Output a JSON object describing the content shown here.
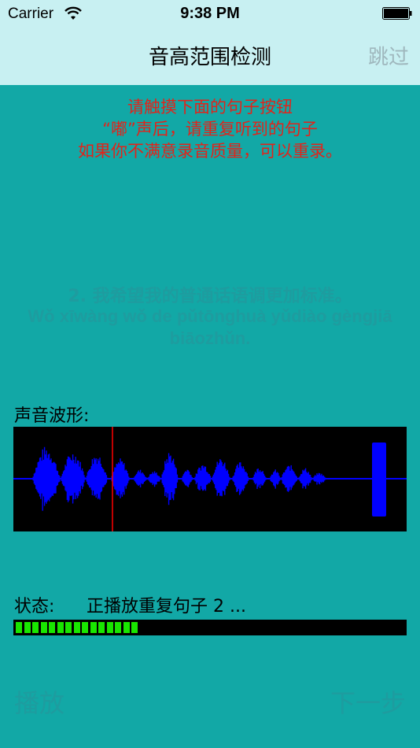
{
  "status_bar": {
    "carrier": "Carrier",
    "time": "9:38 PM"
  },
  "nav": {
    "title": "音高范围检测",
    "skip": "跳过"
  },
  "instructions": [
    "请触摸下面的句子按钮",
    "“嘟”声后，请重复听到的句子",
    "如果你不满意录音质量，可以重录。"
  ],
  "sentence": {
    "chinese": "2. 我希望我的普通话语调更加标准。",
    "pinyin": "Wǒ xīwàng wǒ de pǔtōnghuà yǔdiào gèngjiā biāozhǔn."
  },
  "waveform": {
    "label": "声音波形:",
    "wave_color": "#0000FF",
    "cursor_color": "#FF0000"
  },
  "status": {
    "label": "状态:",
    "text": "正播放重复句子 2 ...",
    "progress": 0.33
  },
  "buttons": {
    "play": "播放",
    "next": "下一步"
  },
  "colors": {
    "background": "#12A8A6",
    "header": "#C8F0F2",
    "instruction_text": "#E2231A",
    "progress": "#19E600"
  },
  "icons": [
    "wifi-icon",
    "battery-icon"
  ]
}
